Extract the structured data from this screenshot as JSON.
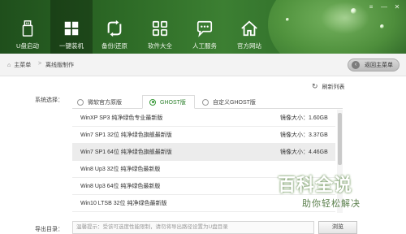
{
  "header": {
    "nav": [
      {
        "label": "U盘启动",
        "icon": "usb-drive-icon"
      },
      {
        "label": "一键装机",
        "icon": "windows-icon",
        "active": true
      },
      {
        "label": "备份/还原",
        "icon": "backup-restore-icon"
      },
      {
        "label": "软件大全",
        "icon": "apps-grid-icon"
      },
      {
        "label": "人工服务",
        "icon": "chat-support-icon"
      },
      {
        "label": "官方网站",
        "icon": "home-icon"
      }
    ]
  },
  "breadcrumb": {
    "home": "主菜单",
    "current": "离线版制作",
    "back_button": "返回主菜单"
  },
  "refresh_label": "刷新列表",
  "system_select": {
    "label": "系统选择：",
    "tabs": [
      {
        "label": "微软官方原版",
        "selected": false
      },
      {
        "label": "GHOST版",
        "selected": true
      },
      {
        "label": "自定义GHOST版",
        "selected": false
      }
    ],
    "rows": [
      {
        "name": "WinXP SP3 纯净绿色专业最新版",
        "size_label": "镜像大小：",
        "size": "1.60GB"
      },
      {
        "name": "Win7 SP1 32位 纯净绿色旗舰最新版",
        "size_label": "镜像大小：",
        "size": "3.37GB"
      },
      {
        "name": "Win7 SP1 64位 纯净绿色旗舰最新版",
        "size_label": "镜像大小：",
        "size": "4.46GB",
        "selected": true
      },
      {
        "name": "Win8 Up3 32位 纯净绿色最新版",
        "size_label": "",
        "size": ""
      },
      {
        "name": "Win8 Up3 64位 纯净绿色最新版",
        "size_label": "",
        "size": ""
      },
      {
        "name": "Win10 LTSB 32位 纯净绿色最新版",
        "size_label": "",
        "size": ""
      }
    ]
  },
  "export": {
    "label": "导出目录：",
    "placeholder": "温馨提示：受该可选度性能限制，请勿将导出路径设置为U盘目录",
    "browse_button": "浏览"
  },
  "watermark": {
    "big": "百科全说",
    "small": "助你轻松解决"
  },
  "colors": {
    "header_green": "#2d6a26",
    "accent_green": "#3a9a3a"
  }
}
